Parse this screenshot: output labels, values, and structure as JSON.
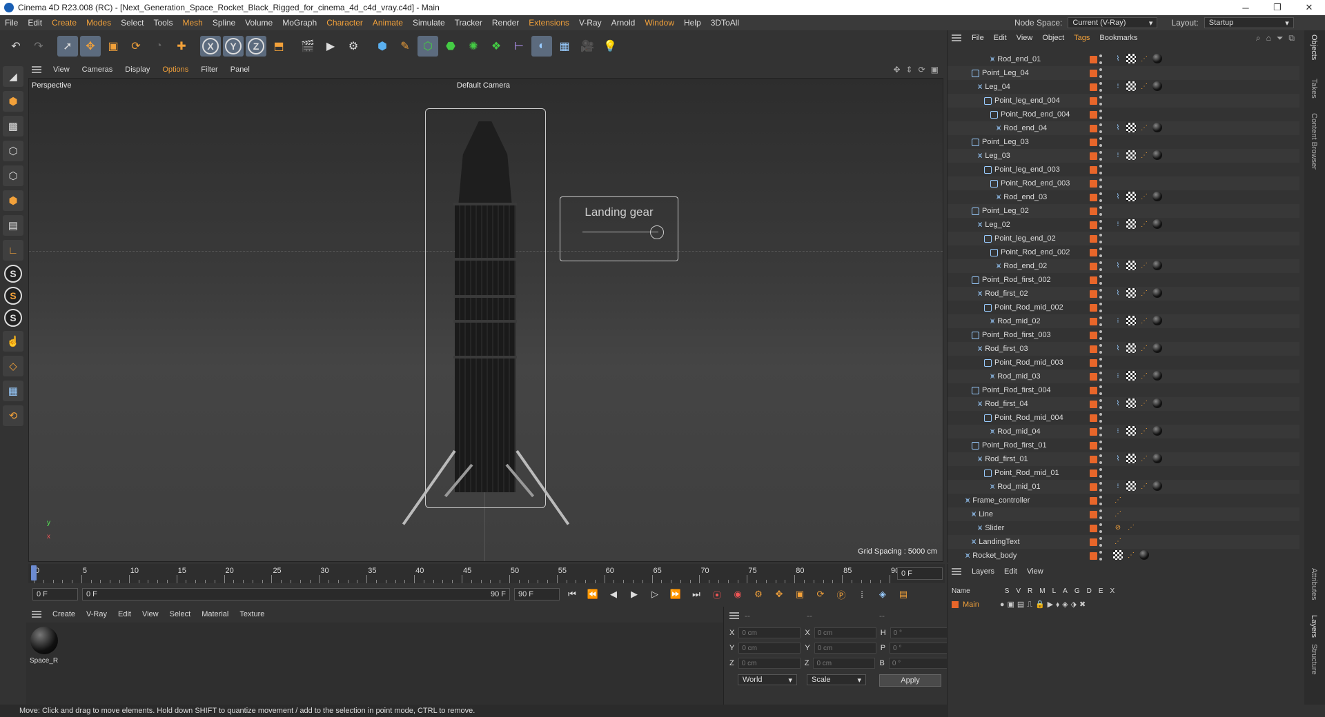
{
  "titlebar": {
    "title": "Cinema 4D R23.008 (RC) - [Next_Generation_Space_Rocket_Black_Rigged_for_cinema_4d_c4d_vray.c4d] - Main",
    "min": "─",
    "max": "❐",
    "close": "✕"
  },
  "menu": [
    "File",
    "Edit",
    "Create",
    "Modes",
    "Select",
    "Tools",
    "Mesh",
    "Spline",
    "Volume",
    "MoGraph",
    "Character",
    "Animate",
    "Simulate",
    "Tracker",
    "Render",
    "Extensions",
    "V-Ray",
    "Arnold",
    "Window",
    "Help",
    "3DToAll"
  ],
  "menu_orange": [
    "Create",
    "Modes",
    "Mesh",
    "Character",
    "Animate",
    "Extensions",
    "Window"
  ],
  "nodespace": {
    "label": "Node Space:",
    "value": "Current (V-Ray)",
    "layout_label": "Layout:",
    "layout_value": "Startup"
  },
  "viewport": {
    "menu": [
      "View",
      "Cameras",
      "Display",
      "Options",
      "Filter",
      "Panel"
    ],
    "label": "Perspective",
    "camera": "Default Camera",
    "grid": "Grid Spacing : 5000 cm",
    "slider_label": "Landing gear",
    "axis_x": "x",
    "axis_y": "y"
  },
  "timeline": {
    "ticks": [
      "0",
      "5",
      "10",
      "15",
      "20",
      "25",
      "30",
      "35",
      "40",
      "45",
      "50",
      "55",
      "60",
      "65",
      "70",
      "75",
      "80",
      "85",
      "90"
    ],
    "current": "0 F"
  },
  "playbar": {
    "start": "0 F",
    "range_start": "0 F",
    "range_end": "90 F",
    "end": "90 F"
  },
  "material": {
    "menu": [
      "Create",
      "V-Ray",
      "Edit",
      "View",
      "Select",
      "Material",
      "Texture"
    ],
    "name": "Space_R"
  },
  "coords": {
    "x": "0 cm",
    "y": "0 cm",
    "z": "0 cm",
    "h": "0 °",
    "p": "0 °",
    "b": "0 °",
    "world": "World",
    "scale": "Scale",
    "apply": "Apply",
    "labels": [
      "X",
      "Y",
      "Z",
      "X",
      "Y",
      "Z",
      "H",
      "P",
      "B"
    ],
    "dash": "--"
  },
  "status": "Move: Click and drag to move elements. Hold down SHIFT to quantize movement / add to the selection in point mode, CTRL to remove.",
  "objects": {
    "menu": [
      "File",
      "Edit",
      "View",
      "Object",
      "Tags",
      "Bookmarks"
    ],
    "rows": [
      {
        "name": "Rod_end_01",
        "indent": 6,
        "kind": "j",
        "tags": "full"
      },
      {
        "name": "Point_Leg_04",
        "indent": 3,
        "kind": "n",
        "tags": ""
      },
      {
        "name": "Leg_04",
        "indent": 4,
        "kind": "j",
        "tags": "full2"
      },
      {
        "name": "Point_leg_end_004",
        "indent": 5,
        "kind": "n",
        "tags": ""
      },
      {
        "name": "Point_Rod_end_004",
        "indent": 6,
        "kind": "n",
        "tags": ""
      },
      {
        "name": "Rod_end_04",
        "indent": 7,
        "kind": "j",
        "tags": "full"
      },
      {
        "name": "Point_Leg_03",
        "indent": 3,
        "kind": "n",
        "tags": ""
      },
      {
        "name": "Leg_03",
        "indent": 4,
        "kind": "j",
        "tags": "full2"
      },
      {
        "name": "Point_leg_end_003",
        "indent": 5,
        "kind": "n",
        "tags": ""
      },
      {
        "name": "Point_Rod_end_003",
        "indent": 6,
        "kind": "n",
        "tags": ""
      },
      {
        "name": "Rod_end_03",
        "indent": 7,
        "kind": "j",
        "tags": "full"
      },
      {
        "name": "Point_Leg_02",
        "indent": 3,
        "kind": "n",
        "tags": ""
      },
      {
        "name": "Leg_02",
        "indent": 4,
        "kind": "j",
        "tags": "full2"
      },
      {
        "name": "Point_leg_end_02",
        "indent": 5,
        "kind": "n",
        "tags": ""
      },
      {
        "name": "Point_Rod_end_002",
        "indent": 6,
        "kind": "n",
        "tags": ""
      },
      {
        "name": "Rod_end_02",
        "indent": 7,
        "kind": "j",
        "tags": "full"
      },
      {
        "name": "Point_Rod_first_002",
        "indent": 3,
        "kind": "n",
        "tags": ""
      },
      {
        "name": "Rod_first_02",
        "indent": 4,
        "kind": "j",
        "tags": "full"
      },
      {
        "name": "Point_Rod_mid_002",
        "indent": 5,
        "kind": "n",
        "tags": ""
      },
      {
        "name": "Rod_mid_02",
        "indent": 6,
        "kind": "j",
        "tags": "full2"
      },
      {
        "name": "Point_Rod_first_003",
        "indent": 3,
        "kind": "n",
        "tags": ""
      },
      {
        "name": "Rod_first_03",
        "indent": 4,
        "kind": "j",
        "tags": "full"
      },
      {
        "name": "Point_Rod_mid_003",
        "indent": 5,
        "kind": "n",
        "tags": ""
      },
      {
        "name": "Rod_mid_03",
        "indent": 6,
        "kind": "j",
        "tags": "full2"
      },
      {
        "name": "Point_Rod_first_004",
        "indent": 3,
        "kind": "n",
        "tags": ""
      },
      {
        "name": "Rod_first_04",
        "indent": 4,
        "kind": "j",
        "tags": "full"
      },
      {
        "name": "Point_Rod_mid_004",
        "indent": 5,
        "kind": "n",
        "tags": ""
      },
      {
        "name": "Rod_mid_04",
        "indent": 6,
        "kind": "j",
        "tags": "full2"
      },
      {
        "name": "Point_Rod_first_01",
        "indent": 3,
        "kind": "n",
        "tags": ""
      },
      {
        "name": "Rod_first_01",
        "indent": 4,
        "kind": "j",
        "tags": "full"
      },
      {
        "name": "Point_Rod_mid_01",
        "indent": 5,
        "kind": "n",
        "tags": ""
      },
      {
        "name": "Rod_mid_01",
        "indent": 6,
        "kind": "j",
        "tags": "full2"
      },
      {
        "name": "Frame_controller",
        "indent": 2,
        "kind": "j",
        "tags": "dot"
      },
      {
        "name": "Line",
        "indent": 3,
        "kind": "j",
        "tags": "dot"
      },
      {
        "name": "Slider",
        "indent": 4,
        "kind": "j",
        "tags": "slider"
      },
      {
        "name": "LandingText",
        "indent": 3,
        "kind": "j",
        "tags": "dot"
      },
      {
        "name": "Rocket_body",
        "indent": 2,
        "kind": "j",
        "tags": "body"
      }
    ]
  },
  "layers": {
    "menu": [
      "Layers",
      "Edit",
      "View"
    ],
    "header": [
      "Name",
      "S",
      "V",
      "R",
      "M",
      "L",
      "A",
      "G",
      "D",
      "E",
      "X"
    ],
    "row": "Main"
  },
  "sidetabs": [
    "Objects",
    "Takes",
    "Content Browser",
    "Attributes",
    "Layers",
    "Structure"
  ]
}
